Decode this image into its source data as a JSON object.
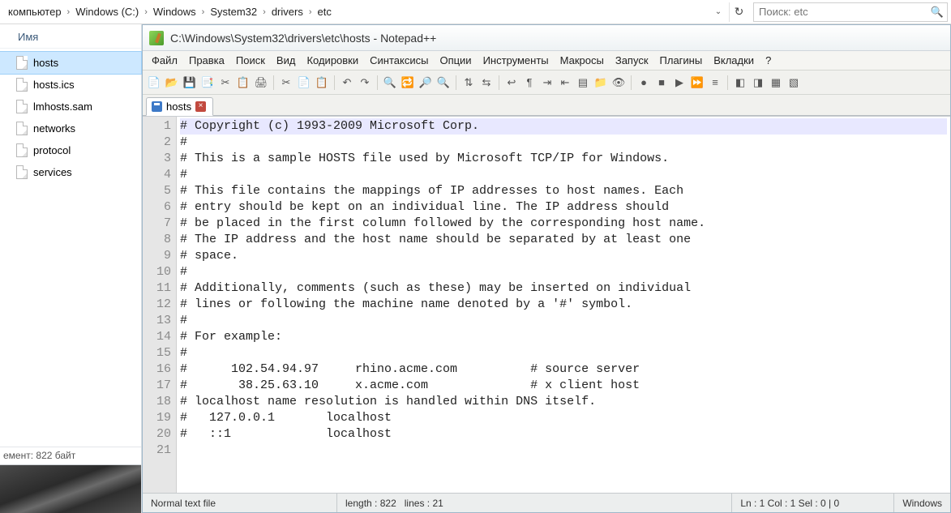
{
  "explorer": {
    "breadcrumbs": [
      "компьютер",
      "Windows (C:)",
      "Windows",
      "System32",
      "drivers",
      "etc"
    ],
    "search_placeholder": "Поиск: etc",
    "column_header": "Имя",
    "files": [
      {
        "name": "hosts",
        "selected": true
      },
      {
        "name": "hosts.ics",
        "selected": false
      },
      {
        "name": "lmhosts.sam",
        "selected": false
      },
      {
        "name": "networks",
        "selected": false
      },
      {
        "name": "protocol",
        "selected": false
      },
      {
        "name": "services",
        "selected": false
      }
    ],
    "status_text": "емент: 822 байт"
  },
  "notepadpp": {
    "title": "C:\\Windows\\System32\\drivers\\etc\\hosts - Notepad++",
    "menu": [
      "Файл",
      "Правка",
      "Поиск",
      "Вид",
      "Кодировки",
      "Синтаксисы",
      "Опции",
      "Инструменты",
      "Макросы",
      "Запуск",
      "Плагины",
      "Вкладки",
      "?"
    ],
    "toolbar_icons": [
      "new-file",
      "open-file",
      "save",
      "copy",
      "cut-doc",
      "paste-doc",
      "print",
      "sep",
      "cut",
      "copy2",
      "paste",
      "sep",
      "undo",
      "redo",
      "sep",
      "find",
      "replace",
      "zoom-in",
      "zoom-out",
      "sep",
      "sync-v",
      "sync-h",
      "sep",
      "wrap",
      "show-all",
      "indent",
      "outdent",
      "doc-map",
      "folder",
      "eye",
      "sep",
      "rec",
      "stop",
      "play",
      "fast",
      "play-list",
      "sep",
      "ext1",
      "ext2",
      "ext3",
      "ext4"
    ],
    "tab": {
      "name": "hosts"
    },
    "lines": [
      "# Copyright (c) 1993-2009 Microsoft Corp.",
      "#",
      "# This is a sample HOSTS file used by Microsoft TCP/IP for Windows.",
      "#",
      "# This file contains the mappings of IP addresses to host names. Each",
      "# entry should be kept on an individual line. The IP address should",
      "# be placed in the first column followed by the corresponding host name.",
      "# The IP address and the host name should be separated by at least one",
      "# space.",
      "#",
      "# Additionally, comments (such as these) may be inserted on individual",
      "# lines or following the machine name denoted by a '#' symbol.",
      "#",
      "# For example:",
      "#",
      "#      102.54.94.97     rhino.acme.com          # source server",
      "#       38.25.63.10     x.acme.com              # x client host",
      "# localhost name resolution is handled within DNS itself.",
      "#   127.0.0.1       localhost",
      "#   ::1             localhost",
      ""
    ],
    "statusbar": {
      "filetype": "Normal text file",
      "length_label": "length :",
      "length_value": "822",
      "lines_label": "lines :",
      "lines_value": "21",
      "pos": "Ln : 1   Col : 1   Sel : 0 | 0",
      "encoding": "Windows"
    }
  }
}
